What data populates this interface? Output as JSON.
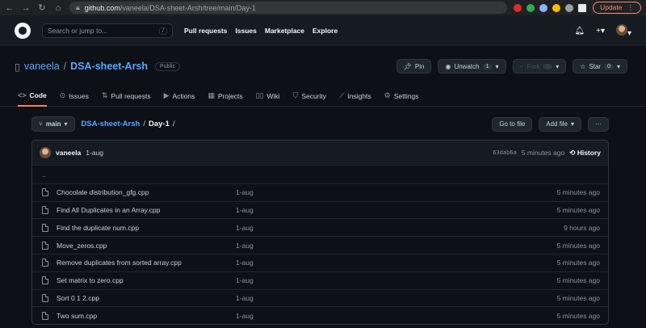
{
  "browser": {
    "url_host": "github.com",
    "url_path": "/vaneela/DSA-sheet-Arsh/tree/main/Day-1",
    "update_label": "Update"
  },
  "header": {
    "search_placeholder": "Search or jump to...",
    "search_shortcut": "/",
    "nav": [
      "Pull requests",
      "Issues",
      "Marketplace",
      "Explore"
    ]
  },
  "repo": {
    "owner": "vaneela",
    "name": "DSA-sheet-Arsh",
    "visibility": "Public",
    "pin_label": "Pin",
    "unwatch_label": "Unwatch",
    "watch_count": "1",
    "fork_label": "Fork",
    "fork_count": "0",
    "star_label": "Star",
    "star_count": "0"
  },
  "tabs": [
    {
      "label": "Code",
      "icon": "code-icon"
    },
    {
      "label": "Issues",
      "icon": "issue-icon"
    },
    {
      "label": "Pull requests",
      "icon": "pull-request-icon"
    },
    {
      "label": "Actions",
      "icon": "play-icon"
    },
    {
      "label": "Projects",
      "icon": "table-icon"
    },
    {
      "label": "Wiki",
      "icon": "book-icon"
    },
    {
      "label": "Security",
      "icon": "shield-icon"
    },
    {
      "label": "Insights",
      "icon": "graph-icon"
    },
    {
      "label": "Settings",
      "icon": "gear-icon"
    }
  ],
  "filenav": {
    "branch": "main",
    "crumb_repo": "DSA-sheet-Arsh",
    "crumb_current": "Day-1",
    "go_to_file": "Go to file",
    "add_file": "Add file",
    "more": "···"
  },
  "commit": {
    "user": "vaneela",
    "message": "1-aug",
    "sha": "63dab6a",
    "age": "5 minutes ago",
    "history_label": "History"
  },
  "updir": "..",
  "files": [
    {
      "name": "Chocolate distribution_gfg.cpp",
      "message": "1-aug",
      "age": "5 minutes ago"
    },
    {
      "name": "Find All Duplicates in an Array.cpp",
      "message": "1-aug",
      "age": "5 minutes ago"
    },
    {
      "name": "Find the duplicate num.cpp",
      "message": "1-aug",
      "age": "9 hours ago"
    },
    {
      "name": "Move_zeros.cpp",
      "message": "1-aug",
      "age": "5 minutes ago"
    },
    {
      "name": "Remove duplicates from sorted array.cpp",
      "message": "1-aug",
      "age": "5 minutes ago"
    },
    {
      "name": "Set matrix to zero.cpp",
      "message": "1-aug",
      "age": "5 minutes ago"
    },
    {
      "name": "Sort 0 1 2.cpp",
      "message": "1-aug",
      "age": "5 minutes ago"
    },
    {
      "name": "Two sum.cpp",
      "message": "1-aug",
      "age": "5 minutes ago"
    }
  ],
  "colors": {
    "bg": "#0d1117",
    "header": "#161b22",
    "link": "#58a6ff",
    "active_tab": "#f78166"
  }
}
